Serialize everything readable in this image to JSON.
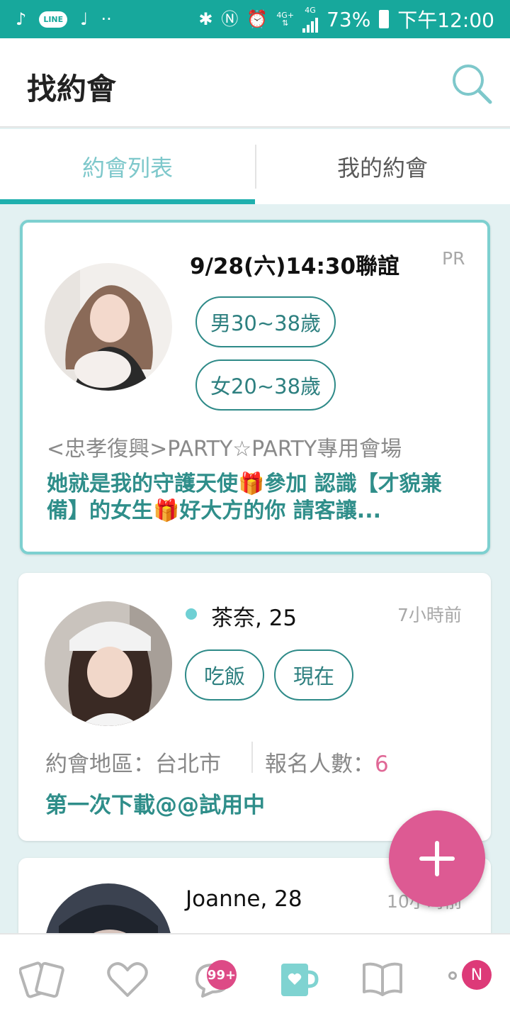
{
  "status_bar": {
    "line_label": "LINE",
    "network_top": "4G+",
    "network_top2": "4G",
    "battery": "73%",
    "time": "下午12:00"
  },
  "header": {
    "title": "找約會"
  },
  "tabs": [
    {
      "label": "約會列表",
      "active": true
    },
    {
      "label": "我的約會",
      "active": false
    }
  ],
  "cards": [
    {
      "title": "9/28(六)14:30聯誼",
      "tag": "PR",
      "pills": [
        "男30~38歲",
        "女20~38歲"
      ],
      "venue": "<忠孝復興>PARTY☆PARTY專用會場",
      "desc_part1": "她就是我的守護天使",
      "desc_part2": "參加 認識【才貌兼備】的女生",
      "desc_part3": "好大方的你 請客讓...",
      "gift_icon": "🎁"
    },
    {
      "name": "茶奈, 25",
      "time": "7小時前",
      "online": true,
      "pills": [
        "吃飯",
        "現在"
      ],
      "area_label": "約會地區：台北市",
      "signup_label": "報名人數：",
      "signup_count": "6",
      "status": "第一次下載@@試用中"
    },
    {
      "name": "Joanne, 28",
      "time": "10小時前"
    }
  ],
  "bottom_nav": {
    "messages_badge": "99+",
    "notify_badge": "N"
  },
  "colors": {
    "status_bar": "#17a89c",
    "accent": "#1fb0ae",
    "fab": "#dd5a93",
    "background": "#e3f1f2"
  }
}
